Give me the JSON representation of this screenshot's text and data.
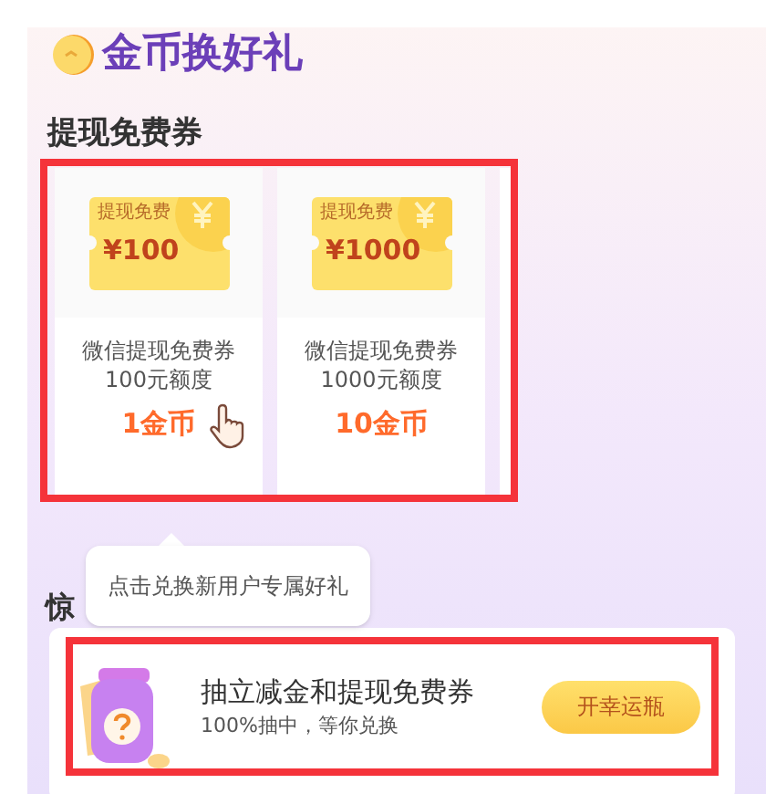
{
  "header": {
    "title": "金币换好礼"
  },
  "sections": [
    {
      "title": "提现免费券",
      "highlighted": true,
      "items": [
        {
          "ticket_label": "提现免费",
          "amount": "¥100",
          "name": "微信提现免费券",
          "quota": "100元额度",
          "price": "1金币",
          "pointer": true
        },
        {
          "ticket_label": "提现免费",
          "amount": "¥1000",
          "name": "微信提现免费券",
          "quota": "1000元额度",
          "price": "10金币",
          "pointer": false
        }
      ]
    }
  ],
  "tooltip": {
    "text": "点击兑换新用户专属好礼"
  },
  "section2": {
    "title": "惊"
  },
  "banner": {
    "title": "抽立减金和提现免费券",
    "subtitle": "100%抽中，等你兑换",
    "button": "开幸运瓶",
    "highlighted": true
  }
}
